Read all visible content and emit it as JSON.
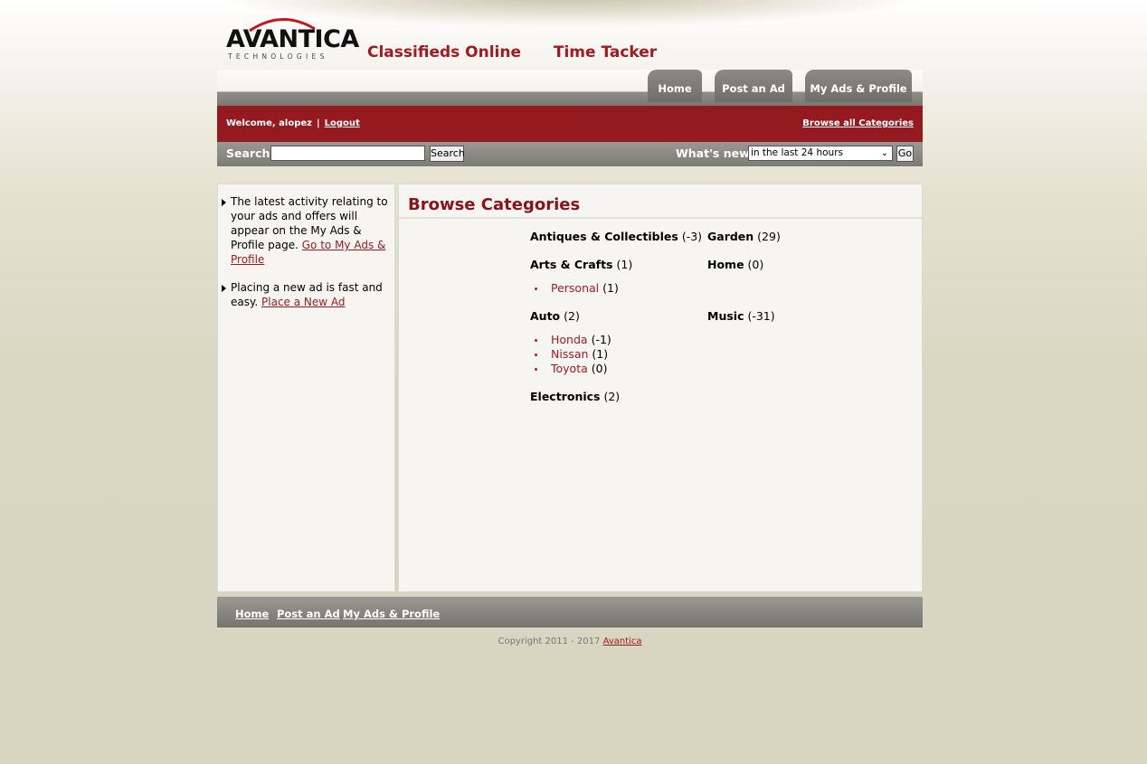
{
  "header": {
    "logo": {
      "word": "AVANTICA",
      "sub": "TECHNOLOGIES"
    },
    "brand_links": [
      "Classifieds Online",
      "Time Tacker"
    ]
  },
  "tabs": {
    "home": "Home",
    "post_ad": "Post an Ad",
    "my_ads": "My Ads & Profile"
  },
  "user_bar": {
    "welcome": "Welcome, alopez",
    "separator": "|",
    "logout": "Logout",
    "browse_all": "Browse all Categories"
  },
  "search": {
    "label": "Search:",
    "value": "",
    "button": "Search",
    "whats_new_label": "What's new:",
    "whats_new_value": "in the last 24 hours",
    "go": "Go"
  },
  "sidebar": {
    "tip1_text": "The latest activity relating to your ads and offers will appear on the My Ads & Profile page.",
    "tip1_link": "Go to My Ads & Profile",
    "tip2_text": "Placing a new ad is fast and easy.",
    "tip2_link": "Place a New Ad"
  },
  "main": {
    "title": "Browse Categories",
    "categories": [
      {
        "name": "Antiques & Collectibles",
        "count": "(-3)",
        "subs": []
      },
      {
        "name": "Arts & Crafts",
        "count": "(1)",
        "subs": [
          {
            "name": "Personal",
            "count": "(1)"
          }
        ]
      },
      {
        "name": "Auto",
        "count": "(2)",
        "subs": [
          {
            "name": "Honda",
            "count": "(-1)"
          },
          {
            "name": "Nissan",
            "count": "(1)"
          },
          {
            "name": "Toyota",
            "count": "(0)"
          }
        ]
      },
      {
        "name": "Electronics",
        "count": "(2)",
        "subs": []
      },
      {
        "name": "Garden",
        "count": "(29)",
        "subs": []
      },
      {
        "name": "Home",
        "count": "(0)",
        "subs": []
      },
      {
        "name": "Music",
        "count": "(-31)",
        "subs": []
      }
    ]
  },
  "footer": {
    "links": [
      "Home",
      "Post an Ad",
      "My Ads & Profile"
    ],
    "copyright": "Copyright 2011 - 2017",
    "copyright_link": "Avantica"
  },
  "colors": {
    "brand_red": "#941a1f",
    "link_red": "#a31a1e",
    "bar_gray": "#7d7b75"
  }
}
